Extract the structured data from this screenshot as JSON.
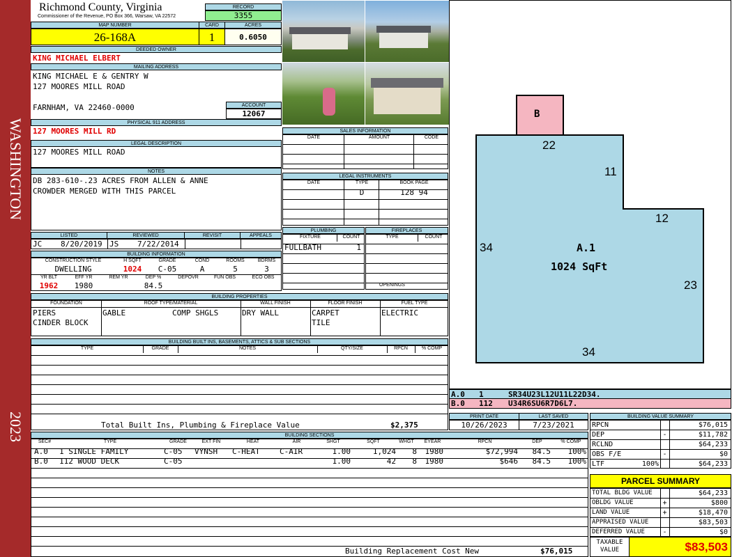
{
  "sidebar": {
    "district": "WASHINGTON",
    "year": "2023"
  },
  "header": {
    "county": "Richmond County, Virginia",
    "commissioner": "Commissioner of the Revenue, PO Box 366, Warsaw, VA 22572",
    "record_label": "RECORD",
    "record": "3355",
    "map_number_label": "MAP NUMBER",
    "map_number": "26-168A",
    "card_label": "CARD",
    "card": "1",
    "acres_label": "ACRES",
    "acres": "0.6050"
  },
  "owner": {
    "deeded_owner_label": "DEEDED OWNER",
    "deeded_owner": "KING MICHAEL ELBERT",
    "mailing_label": "MAILING ADDRESS",
    "mailing_line1": "KING MICHAEL E & GENTRY W",
    "mailing_line2": "127 MOORES MILL ROAD",
    "mailing_line3": "FARNHAM, VA 22460-0000",
    "account_label": "ACCOUNT",
    "account": "12067",
    "physical_label": "PHYSICAL 911 ADDRESS",
    "physical": "127 MOORES MILL RD",
    "legal_label": "LEGAL DESCRIPTION",
    "legal": "127 MOORES MILL ROAD",
    "notes_label": "NOTES",
    "notes_line1": "DB 283-610-.23 ACRES FROM ALLEN & ANNE",
    "notes_line2": "CROWDER MERGED WITH THIS PARCEL"
  },
  "sales": {
    "title": "SALES INFORMATION",
    "col_date": "DATE",
    "col_amount": "AMOUNT",
    "col_code": "CODE"
  },
  "legal_instruments": {
    "title": "LEGAL INSTRUMENTS",
    "col_date": "DATE",
    "col_type": "TYPE",
    "col_book": "BOOK PAGE",
    "rows": [
      {
        "date": "",
        "type": "D",
        "book": "128 94"
      }
    ]
  },
  "listing": {
    "listed_label": "LISTED",
    "reviewed_label": "REVIEWED",
    "revisit_label": "REVISIT",
    "appeals_label": "APPEALS",
    "listed_by": "JC",
    "listed_date": "8/20/2019",
    "reviewed_by": "JS",
    "reviewed_date": "7/22/2014"
  },
  "plumbing": {
    "title": "PLUMBING",
    "col_fixture": "FIXTURE",
    "col_count": "COUNT",
    "fixture": "FULLBATH",
    "count": "1"
  },
  "fireplaces": {
    "title": "FIREPLACES",
    "col_type": "TYPE",
    "col_count": "COUNT",
    "openings_label": "OPENINGS"
  },
  "building_info": {
    "title": "BUILDING INFORMATION",
    "labels": {
      "style": "CONSTRUCTION STYLE",
      "hsqft": "H SQFT",
      "grade": "GRADE",
      "cond": "COND",
      "rooms": "ROOMS",
      "bdrms": "BDRMS",
      "yrblt": "YR BLT",
      "effyr": "EFF YR",
      "remyr": "REM YR",
      "dep": "DEP %",
      "depovr": "DEPOVR",
      "funobs": "FUN OBS",
      "ecoobs": "ECO OBS"
    },
    "style": "DWELLING",
    "hsqft": "1024",
    "grade": "C-05",
    "cond": "A",
    "rooms": "5",
    "bdrms": "3",
    "yrblt": "1962",
    "effyr": "1980",
    "dep": "84.5"
  },
  "properties": {
    "title": "BUILDING PROPERTIES",
    "labels": {
      "foundation": "FOUNDATION",
      "roof": "ROOF TYPE/MATERIAL",
      "wall": "WALL FINISH",
      "floor": "FLOOR FINISH",
      "fuel": "FUEL TYPE"
    },
    "foundation1": "PIERS",
    "foundation2": "CINDER BLOCK",
    "roof_type": "GABLE",
    "roof_material": "COMP SHGLS",
    "wall": "DRY WALL",
    "floor1": "CARPET",
    "floor2": "TILE",
    "fuel": "ELECTRIC"
  },
  "builtins": {
    "title": "BUILDING BUILT INS, BASEMENTS, ATTICS & SUB SECTIONS",
    "col_type": "TYPE",
    "col_grade": "GRADE",
    "col_notes": "NOTES",
    "col_qty": "QTY/SIZE",
    "col_rpcn": "RPCN",
    "col_comp": "% COMP",
    "total_label": "Total Built Ins, Plumbing & Fireplace Value",
    "total": "$2,375"
  },
  "print": {
    "print_label": "PRINT DATE",
    "print_date": "10/26/2023",
    "saved_label": "LAST SAVED",
    "saved_date": "7/23/2021"
  },
  "sections": {
    "title": "BUILDING SECTIONS",
    "headers": [
      "SEC#",
      "TYPE",
      "GRADE",
      "EXT FIN",
      "HEAT",
      "AIR",
      "SHGT",
      "SQFT",
      "WHGT",
      "EYEAR",
      "RPCN",
      "DEP",
      "% COMP"
    ],
    "rows": [
      {
        "sec": "A.0",
        "type": "1 SINGLE FAMILY",
        "grade": "C-05",
        "ext": "VYNSH",
        "heat": "C-HEAT",
        "air": "C-AIR",
        "shgt": "1.00",
        "sqft": "1,024",
        "whgt": "8",
        "eyear": "1980",
        "rpcn": "$72,994",
        "dep": "84.5",
        "comp": "100%"
      },
      {
        "sec": "B.0",
        "type": "112 WOOD DECK",
        "grade": "C-05",
        "ext": "",
        "heat": "",
        "air": "",
        "shgt": "1.00",
        "sqft": "42",
        "whgt": "8",
        "eyear": "1980",
        "rpcn": "$646",
        "dep": "84.5",
        "comp": "100%"
      }
    ],
    "replacement_label": "Building Replacement Cost New",
    "replacement": "$76,015"
  },
  "sketch": {
    "label_b": "B",
    "label_a": "A.1",
    "area": "1024 SqFt",
    "dims": {
      "top": "22",
      "right_upper": "11",
      "step": "12",
      "left": "34",
      "right_lower": "23",
      "bottom": "34"
    },
    "legend": [
      {
        "id": "A.0",
        "code": "1",
        "vectors": "SR34U23L12U11L22D34.",
        "color": "#add8e6"
      },
      {
        "id": "B.0",
        "code": "112",
        "vectors": "U34R6SU6R7D6L7.",
        "color": "#f5b6c1"
      }
    ]
  },
  "value_summary": {
    "title": "BUILDING VALUE SUMMARY",
    "rows": [
      {
        "label": "RPCN",
        "pct": "",
        "sign": "",
        "value": "$76,015"
      },
      {
        "label": "DEP",
        "pct": "",
        "sign": "-",
        "value": "$11,782"
      },
      {
        "label": "RCLND",
        "pct": "",
        "sign": "",
        "value": "$64,233"
      },
      {
        "label": "OBS F/E",
        "pct": "",
        "sign": "-",
        "value": "$0"
      },
      {
        "label": "LTF",
        "pct": "100%",
        "sign": "",
        "value": "$64,233"
      }
    ]
  },
  "parcel_summary": {
    "title": "PARCEL SUMMARY",
    "rows": [
      {
        "label": "TOTAL BLDG VALUE",
        "sign": "",
        "value": "$64,233"
      },
      {
        "label": "OBLDG VALUE",
        "sign": "+",
        "value": "$800"
      },
      {
        "label": "LAND VALUE",
        "sign": "+",
        "value": "$18,470"
      },
      {
        "label": "APPRAISED VALUE",
        "sign": "",
        "value": "$83,503"
      },
      {
        "label": "DEFERRED VALUE",
        "sign": "-",
        "value": "$0"
      }
    ],
    "taxable_label1": "TAXABLE",
    "taxable_label2": "VALUE",
    "taxable": "$83,503",
    "accent": "#ffff00"
  }
}
